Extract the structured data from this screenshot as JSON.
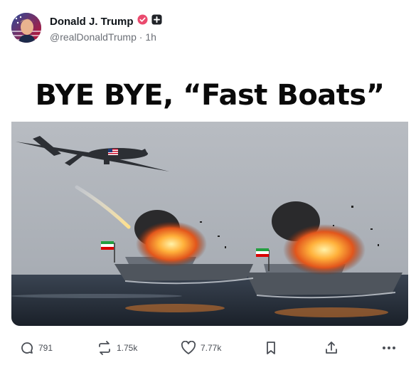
{
  "post": {
    "author_name": "Donald J. Trump",
    "handle": "@realDonaldTrump",
    "separator": "·",
    "time": "1h"
  },
  "media": {
    "headline": "BYE BYE, “Fast Boats”"
  },
  "actions": {
    "replies": "791",
    "reposts": "1.75k",
    "likes": "7.77k"
  },
  "icons": {
    "verified": "verified-badge-icon",
    "account_badge": "plus-badge-icon",
    "reply": "comment-icon",
    "repost": "repost-icon",
    "like": "heart-icon",
    "bookmark": "bookmark-icon",
    "share": "share-icon",
    "more": "more-dots-icon"
  },
  "colors": {
    "verified": "#ea4a6e",
    "text_primary": "#0f1419",
    "text_secondary": "#6b6f76"
  }
}
